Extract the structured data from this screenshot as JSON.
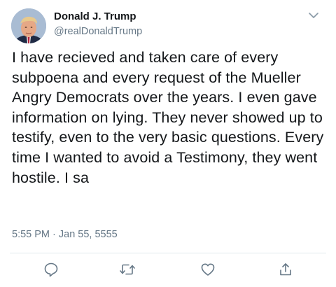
{
  "author": {
    "display_name": "Donald J. Trump",
    "handle": "@realDonaldTrump"
  },
  "tweet": {
    "text": "I have recieved and taken care of every subpoena and every request of the Mueller Angry Democrats over the years. I even gave information on lying. They never showed up to testify, even to the very basic questions. Every time I wanted to avoid a Testimony, they went hostile. I sa",
    "timestamp": "5:55 PM · Jan 55, 5555"
  },
  "colors": {
    "text": "#14171a",
    "secondary": "#657786",
    "divider": "#e1e8ed"
  },
  "icons": {
    "caret": "chevron-down-icon",
    "reply": "reply-icon",
    "retweet": "retweet-icon",
    "like": "heart-icon",
    "share": "share-icon"
  }
}
